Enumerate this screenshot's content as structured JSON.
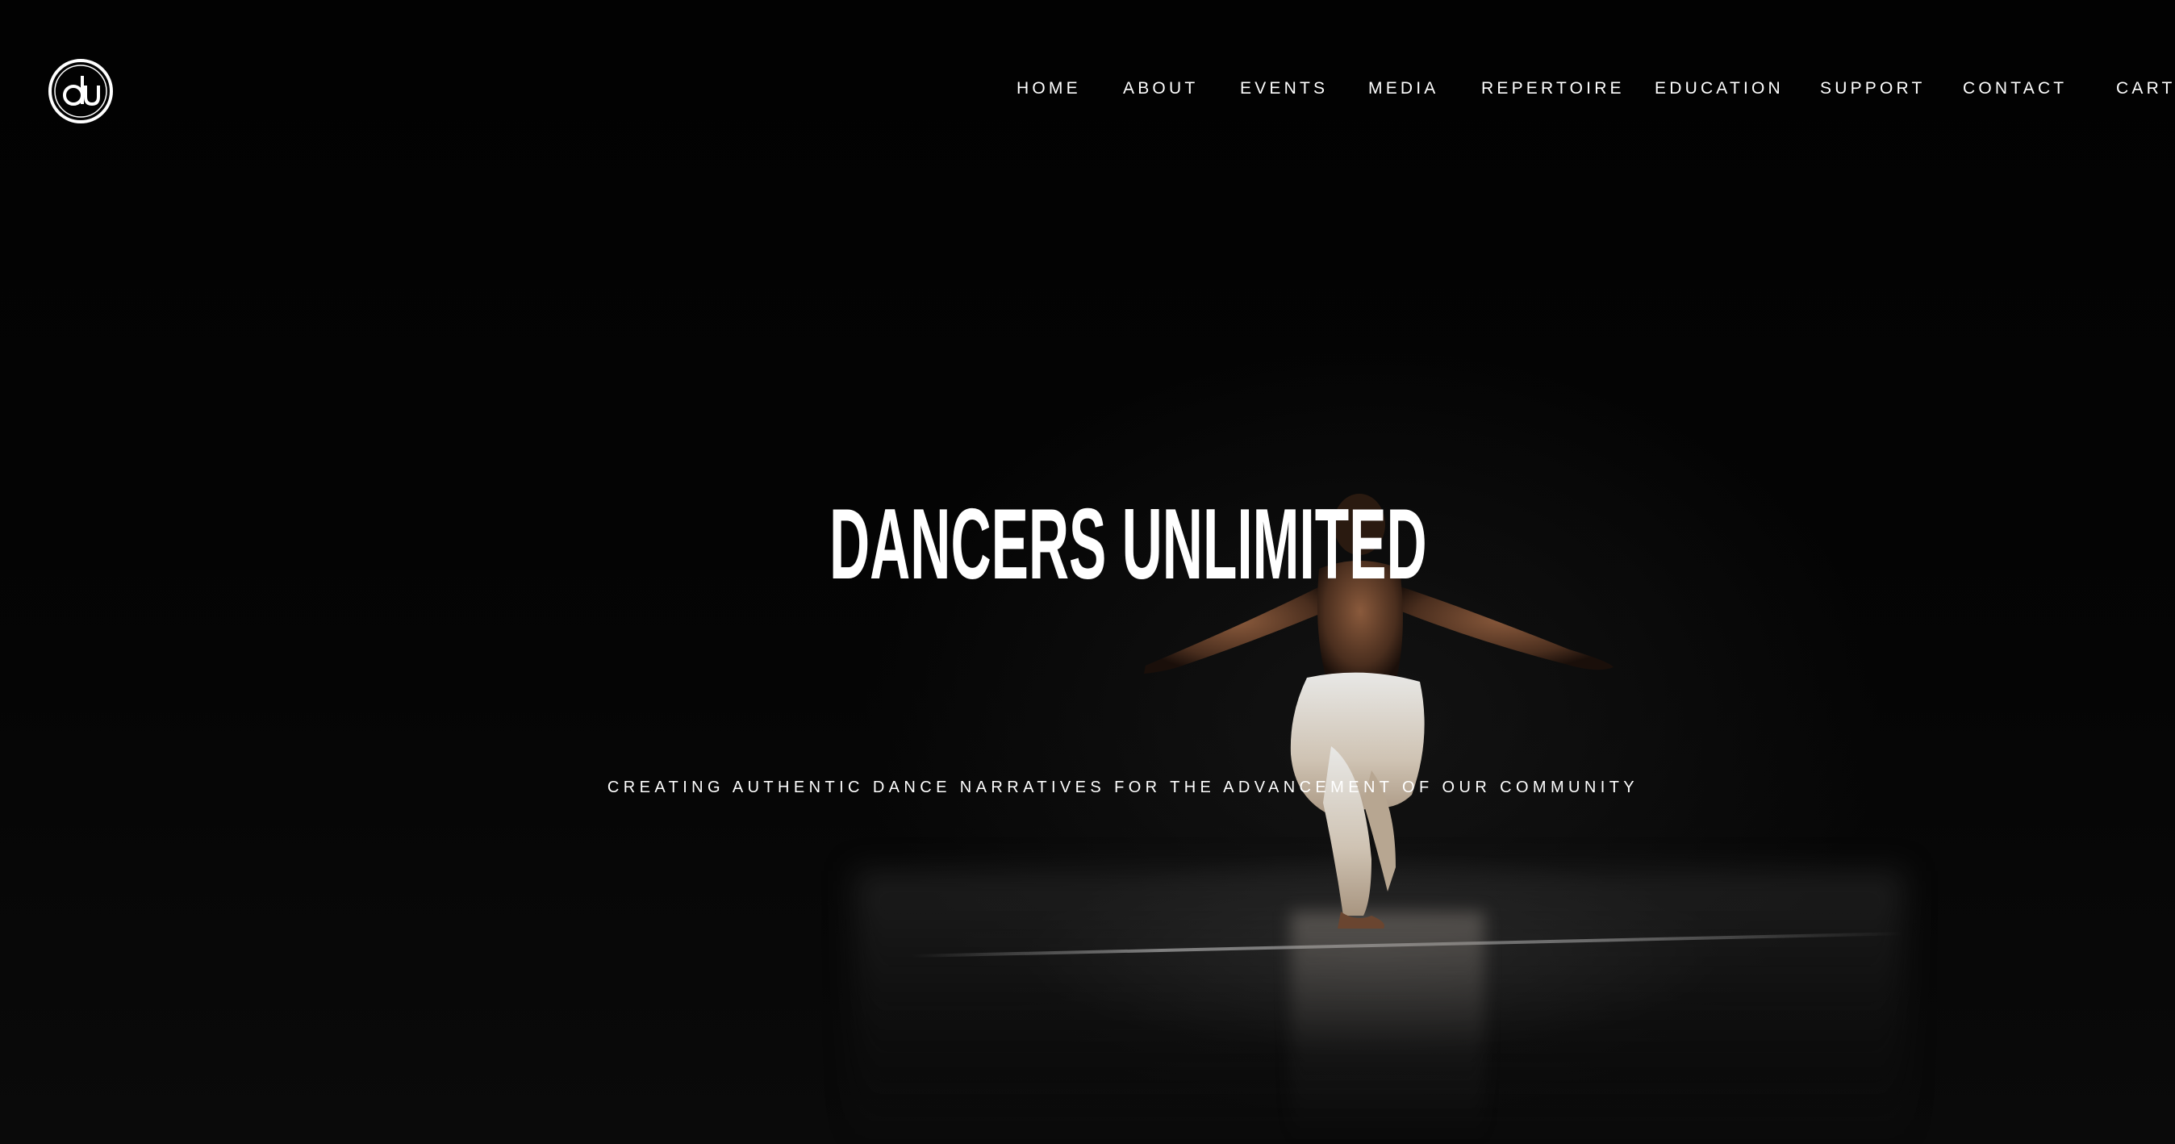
{
  "brand": {
    "logo_icon": "du-monogram-logo"
  },
  "nav": {
    "items": [
      {
        "label": "HOME"
      },
      {
        "label": "ABOUT"
      },
      {
        "label": "EVENTS"
      },
      {
        "label": "MEDIA"
      },
      {
        "label": "REPERTOIRE"
      },
      {
        "label": "EDUCATION"
      },
      {
        "label": "SUPPORT"
      },
      {
        "label": "CONTACT"
      },
      {
        "label": "CART"
      }
    ]
  },
  "hero": {
    "title": "DANCERS UNLIMITED",
    "tagline": "CREATING AUTHENTIC DANCE NARRATIVES FOR THE ADVANCEMENT OF OUR COMMUNITY",
    "background": "dancer-on-stage-video"
  },
  "colors": {
    "background": "#030303",
    "text": "#ffffff"
  }
}
